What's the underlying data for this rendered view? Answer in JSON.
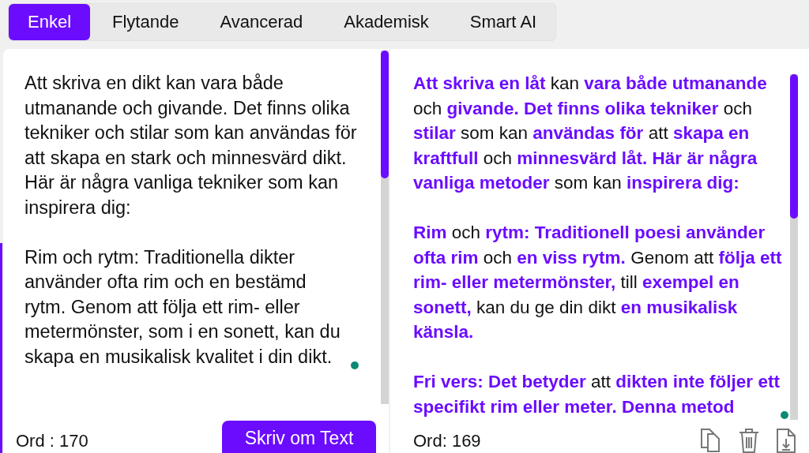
{
  "tabs": [
    {
      "label": "Enkel",
      "selected": true
    },
    {
      "label": "Flytande",
      "selected": false
    },
    {
      "label": "Avancerad",
      "selected": false
    },
    {
      "label": "Akademisk",
      "selected": false
    },
    {
      "label": "Smart AI",
      "selected": false
    }
  ],
  "input_panel": {
    "paragraphs": [
      "Att skriva en dikt kan vara både utmanande och givande. Det finns olika tekniker och stilar som kan användas för att skapa en stark och minnesvärd dikt. Här är några vanliga tekniker som kan inspirera dig:",
      "Rim och rytm: Traditionella dikter använder ofta rim och en bestämd rytm. Genom att följa ett rim- eller metermönster, som i en sonett, kan du skapa en musikalisk kvalitet i din dikt."
    ],
    "word_count": "Ord : 170",
    "button": "Skriv om Text"
  },
  "output_panel": {
    "paragraphs": [
      [
        {
          "text": "Att skriva en låt",
          "changed": true
        },
        {
          "text": " kan ",
          "changed": false
        },
        {
          "text": "vara både utmanande",
          "changed": true
        },
        {
          "text": " och ",
          "changed": false
        },
        {
          "text": "givande. Det finns olika tekniker",
          "changed": true
        },
        {
          "text": " och ",
          "changed": false
        },
        {
          "text": "stilar",
          "changed": true
        },
        {
          "text": " som kan ",
          "changed": false
        },
        {
          "text": "användas för",
          "changed": true
        },
        {
          "text": " att ",
          "changed": false
        },
        {
          "text": "skapa en kraftfull",
          "changed": true
        },
        {
          "text": " och ",
          "changed": false
        },
        {
          "text": "minnesvärd låt. Här är några vanliga metoder",
          "changed": true
        },
        {
          "text": " som kan ",
          "changed": false
        },
        {
          "text": "inspirera dig:",
          "changed": true
        }
      ],
      [
        {
          "text": "Rim",
          "changed": true
        },
        {
          "text": " och ",
          "changed": false
        },
        {
          "text": "rytm: Traditionell poesi använder ofta rim",
          "changed": true
        },
        {
          "text": " och ",
          "changed": false
        },
        {
          "text": "en viss rytm.",
          "changed": true
        },
        {
          "text": " Genom att ",
          "changed": false
        },
        {
          "text": "följa ett rim- eller metermönster,",
          "changed": true
        },
        {
          "text": " till ",
          "changed": false
        },
        {
          "text": "exempel en sonett,",
          "changed": true
        },
        {
          "text": " kan du ge din dikt ",
          "changed": false
        },
        {
          "text": "en musikalisk känsla.",
          "changed": true
        }
      ],
      [
        {
          "text": "Fri vers: Det betyder",
          "changed": true
        },
        {
          "text": " att ",
          "changed": false
        },
        {
          "text": "dikten inte följer ett specifikt rim eller meter. Denna metod",
          "changed": true
        }
      ]
    ],
    "word_count": "Ord: 169"
  }
}
